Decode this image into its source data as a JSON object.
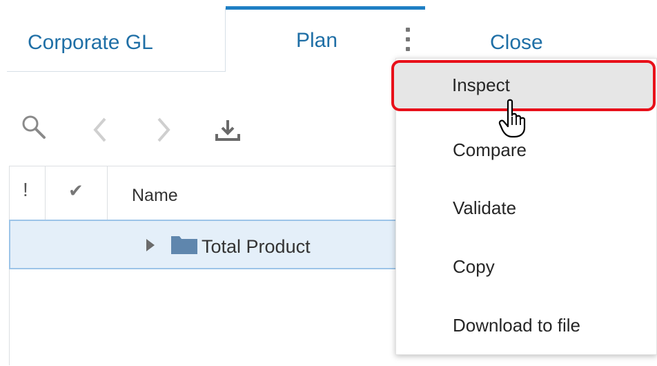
{
  "tabs": [
    {
      "label": "Corporate GL",
      "active": false
    },
    {
      "label": "Plan",
      "active": true
    },
    {
      "label": "Close",
      "active": false
    }
  ],
  "tab_more_icon": "vertical-ellipsis-icon",
  "toolbar": {
    "icons": [
      "search-icon",
      "chevron-left-icon",
      "chevron-right-icon",
      "download-icon"
    ]
  },
  "grid": {
    "columns": [
      "!",
      "✔",
      "Name"
    ],
    "rows": [
      {
        "name": "Total Product",
        "expandable": true,
        "icon": "folder-icon",
        "selected": true
      }
    ]
  },
  "context_menu": {
    "items": [
      {
        "label": "Inspect",
        "highlighted": true
      },
      {
        "label": "Compare"
      },
      {
        "label": "Validate"
      },
      {
        "label": "Copy"
      },
      {
        "label": "Download to file"
      }
    ]
  },
  "colors": {
    "accent": "#1f7fc4",
    "tab_text": "#1f6fa6",
    "selection_bg": "#e4eff9",
    "highlight_border": "#e8101a"
  }
}
